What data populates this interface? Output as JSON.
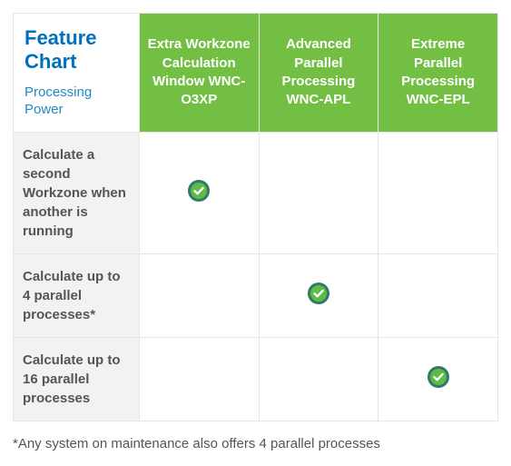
{
  "header": {
    "title": "Feature Chart",
    "subtitle": "Processing Power"
  },
  "plans": [
    {
      "name": "Extra Workzone Calculation Window WNC-O3XP"
    },
    {
      "name": "Advanced Parallel Processing WNC-APL"
    },
    {
      "name": "Extreme Parallel Processing WNC-EPL"
    }
  ],
  "features": [
    {
      "label": "Calculate a second Workzone when another is running",
      "availability": [
        true,
        false,
        false
      ]
    },
    {
      "label": "Calculate up to 4 parallel processes*",
      "availability": [
        false,
        true,
        false
      ]
    },
    {
      "label": "Calculate up to 16 parallel processes",
      "availability": [
        false,
        false,
        true
      ]
    }
  ],
  "footnote": "*Any system on maintenance also offers 4 parallel processes",
  "chart_data": {
    "type": "table",
    "title": "Feature Chart — Processing Power",
    "columns": [
      "Extra Workzone Calculation Window WNC-O3XP",
      "Advanced Parallel Processing WNC-APL",
      "Extreme Parallel Processing WNC-EPL"
    ],
    "rows": [
      "Calculate a second Workzone when another is running",
      "Calculate up to 4 parallel processes*",
      "Calculate up to 16 parallel processes"
    ],
    "values": [
      [
        true,
        false,
        false
      ],
      [
        false,
        true,
        false
      ],
      [
        false,
        false,
        true
      ]
    ]
  }
}
